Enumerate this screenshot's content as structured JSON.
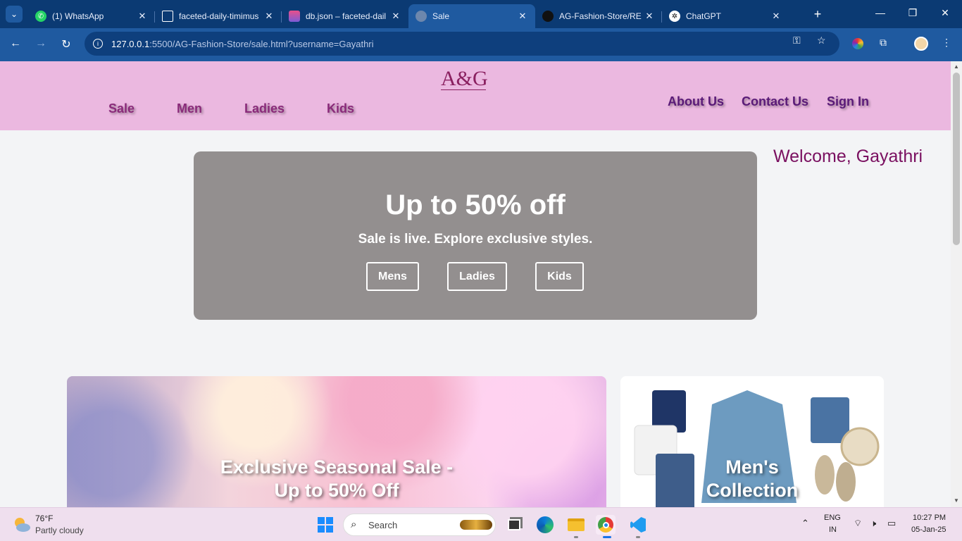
{
  "browser": {
    "tabs": [
      {
        "title": "(1) WhatsApp",
        "icon": "whatsapp-icon"
      },
      {
        "title": "faceted-daily-timimus",
        "icon": "codesandbox-icon"
      },
      {
        "title": "db.json – faceted-dail",
        "icon": "stack-icon"
      },
      {
        "title": "Sale",
        "icon": "globe-icon",
        "active": true
      },
      {
        "title": "AG-Fashion-Store/RE",
        "icon": "github-icon"
      },
      {
        "title": "ChatGPT",
        "icon": "chatgpt-icon"
      }
    ],
    "url_host": "127.0.0.1",
    "url_path": ":5500/AG-Fashion-Store/sale.html?username=Gayathri"
  },
  "site": {
    "logo": "A&G",
    "nav_left": [
      "Sale",
      "Men",
      "Ladies",
      "Kids"
    ],
    "nav_right": [
      "About Us",
      "Contact Us",
      "Sign In"
    ],
    "welcome": "Welcome, Gayathri"
  },
  "hero": {
    "title": "Up to 50% off",
    "subtitle": "Sale is live. Explore exclusive styles.",
    "buttons": [
      "Mens",
      "Ladies",
      "Kids"
    ]
  },
  "cards": {
    "sale_line1": "Exclusive Seasonal Sale -",
    "sale_line2": "Up to 50% Off",
    "men_line1": "Men's",
    "men_line2": "Collection"
  },
  "taskbar": {
    "temp": "76°F",
    "weather": "Partly cloudy",
    "search": "Search",
    "lang1": "ENG",
    "lang2": "IN",
    "time": "10:27 PM",
    "date": "05-Jan-25"
  },
  "colors": {
    "header_bg": "#ebb8e0",
    "brand": "#8a2060",
    "hero_bg": "#938f8f",
    "chrome": "#1f5aa0"
  }
}
